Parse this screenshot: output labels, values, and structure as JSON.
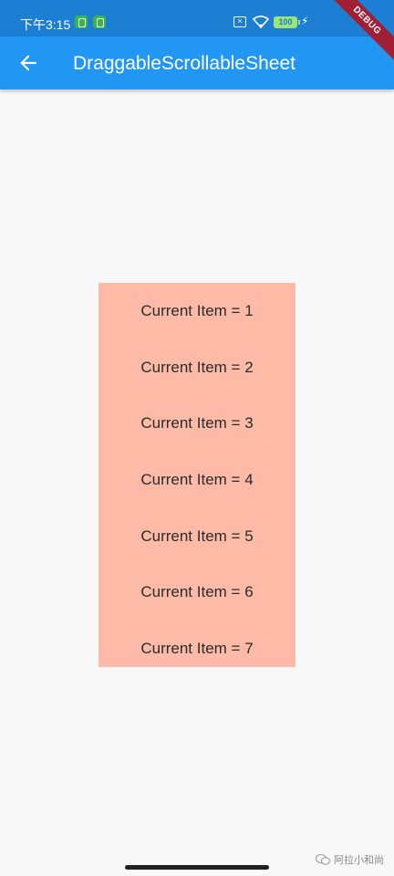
{
  "status_bar": {
    "time": "下午3:15",
    "battery": "100",
    "background": "#1c7fd4"
  },
  "app_bar": {
    "title": "DraggableScrollableSheet",
    "background": "#2196f3",
    "back_icon": "arrow-left-icon"
  },
  "debug_banner": "DEBUG",
  "sheet": {
    "background": "#fdbba7",
    "items": [
      "Current Item = 1",
      "Current Item = 2",
      "Current Item = 3",
      "Current Item = 4",
      "Current Item = 5",
      "Current Item = 6",
      "Current Item = 7"
    ]
  },
  "watermark": "阿拉小和尚"
}
